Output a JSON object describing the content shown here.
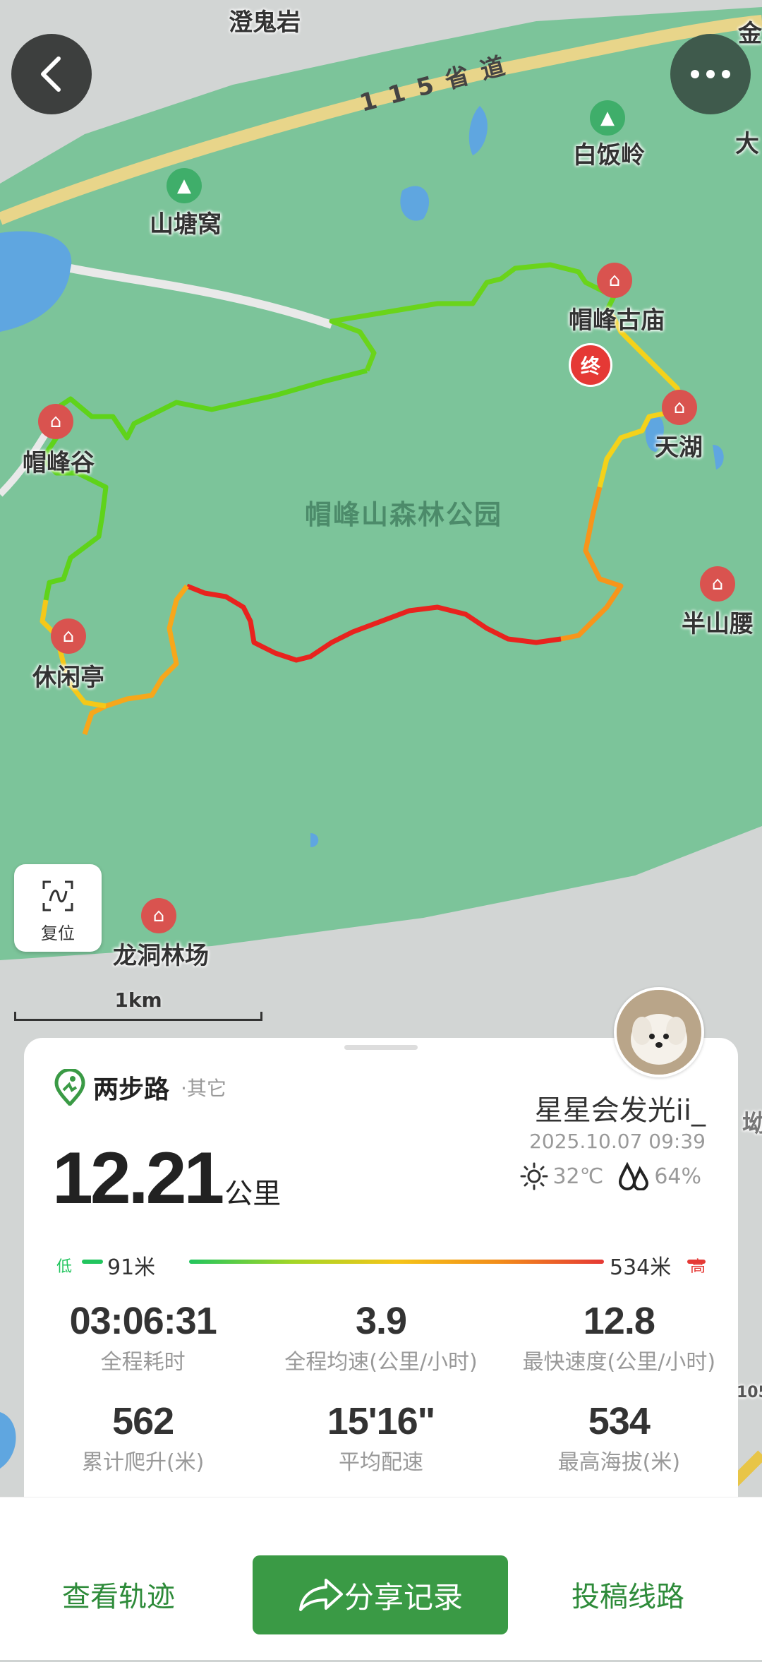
{
  "map": {
    "park_name": "帽峰山森林公园",
    "road_name": "115省道",
    "places": [
      {
        "name": "澄鬼岩",
        "type": "text"
      },
      {
        "name": "白饭岭",
        "type": "mountain"
      },
      {
        "name": "山塘窝",
        "type": "mountain"
      },
      {
        "name": "帽峰古庙",
        "type": "temple"
      },
      {
        "name": "天湖",
        "type": "temple"
      },
      {
        "name": "帽峰谷",
        "type": "temple"
      },
      {
        "name": "半山腰",
        "type": "temple"
      },
      {
        "name": "休闲亭",
        "type": "temple"
      },
      {
        "name": "龙洞林场",
        "type": "temple"
      },
      {
        "name": "大",
        "type": "mountain"
      },
      {
        "name": "金",
        "type": "text"
      }
    ],
    "end_marker": "终",
    "reset_label": "复位",
    "scale_label": "1km",
    "edge_labels": [
      "坳",
      "105"
    ]
  },
  "header": {
    "back_icon": "chevron-left-icon",
    "more_icon": "more-dots-icon"
  },
  "record": {
    "brand": "两步路",
    "category": "·其它",
    "username": "星星会发光ii_",
    "datetime": "2025.10.07 09:39",
    "temperature": "32℃",
    "humidity": "64%",
    "distance_value": "12.21",
    "distance_unit": "公里",
    "altitude": {
      "low_label": "低",
      "high_label": "高",
      "min": "91米",
      "max": "534米"
    },
    "stats": [
      {
        "value": "03:06:31",
        "label": "全程耗时"
      },
      {
        "value": "3.9",
        "label": "全程均速(公里/小时)"
      },
      {
        "value": "12.8",
        "label": "最快速度(公里/小时)"
      },
      {
        "value": "562",
        "label": "累计爬升(米)"
      },
      {
        "value": "15'16\"",
        "label": "平均配速"
      },
      {
        "value": "534",
        "label": "最高海拔(米)"
      }
    ]
  },
  "actions": {
    "view_track": "查看轨迹",
    "share": "分享记录",
    "submit_route": "投稿线路"
  },
  "colors": {
    "park_green": "#7cc49a",
    "primary_green": "#3a9a45",
    "low": "#22c55e",
    "high": "#e53935"
  }
}
